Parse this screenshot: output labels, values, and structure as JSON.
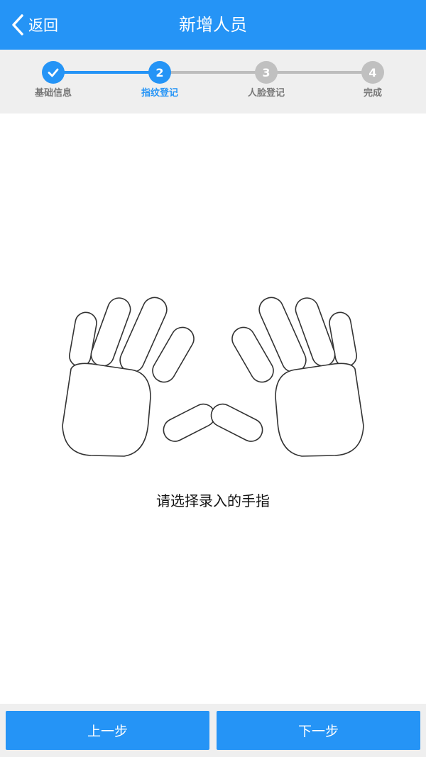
{
  "header": {
    "back_label": "返回",
    "title": "新增人员"
  },
  "steps": [
    {
      "num": "1",
      "label": "基础信息",
      "state": "done"
    },
    {
      "num": "2",
      "label": "指纹登记",
      "state": "active"
    },
    {
      "num": "3",
      "label": "人脸登记",
      "state": "pending"
    },
    {
      "num": "4",
      "label": "完成",
      "state": "pending"
    }
  ],
  "main": {
    "prompt": "请选择录入的手指"
  },
  "footer": {
    "prev_label": "上一步",
    "next_label": "下一步"
  },
  "colors": {
    "primary": "#2594f6",
    "inactive": "#c0c0c0"
  }
}
